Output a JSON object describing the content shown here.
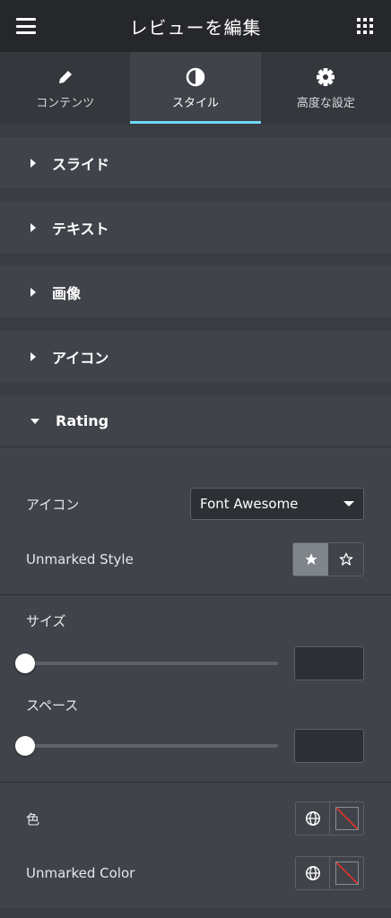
{
  "header": {
    "title": "レビューを編集",
    "menu_icon": "hamburger-icon",
    "apps_icon": "grid-icon"
  },
  "tabs": [
    {
      "label": "コンテンツ",
      "icon": "pencil-icon",
      "active": false
    },
    {
      "label": "スタイル",
      "icon": "contrast-icon",
      "active": true
    },
    {
      "label": "高度な設定",
      "icon": "gear-icon",
      "active": false
    }
  ],
  "sections": [
    {
      "label": "スライド"
    },
    {
      "label": "テキスト"
    },
    {
      "label": "画像"
    },
    {
      "label": "アイコン"
    }
  ],
  "rating": {
    "label": "Rating",
    "icon_label": "アイコン",
    "icon_value": "Font Awesome",
    "unmarked_style_label": "Unmarked Style",
    "size_label": "サイズ",
    "size_value": 0,
    "space_label": "スペース",
    "space_value": 0,
    "color_label": "色",
    "unmarked_color_label": "Unmarked Color"
  },
  "colors": {
    "accent": "#71d7f7",
    "panel": "#404349",
    "header": "#25272b"
  }
}
